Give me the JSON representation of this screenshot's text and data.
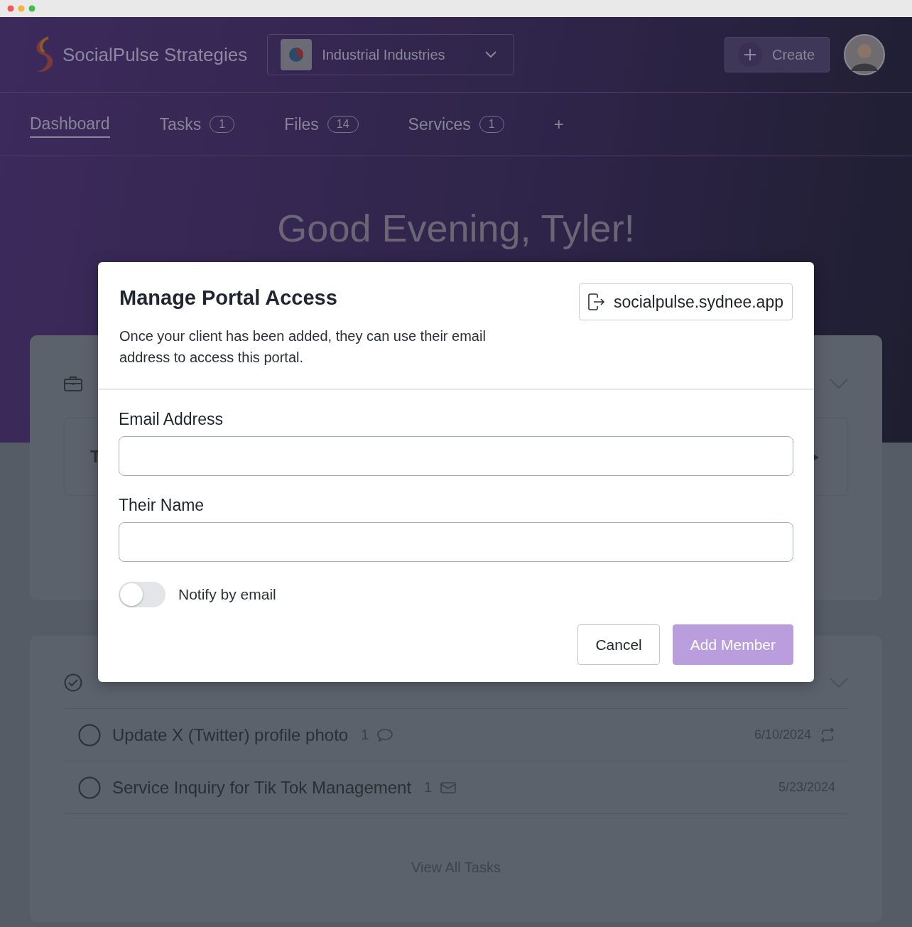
{
  "header": {
    "brand": "SocialPulse Strategies",
    "workspace": "Industrial Industries",
    "create_button": "Create"
  },
  "tabs": [
    {
      "label": "Dashboard",
      "selected": true
    },
    {
      "label": "Tasks",
      "count": "1",
      "selected": false
    },
    {
      "label": "Files",
      "count": "14",
      "selected": false
    },
    {
      "label": "Services",
      "count": "1",
      "selected": false
    }
  ],
  "add_tab": "+",
  "greeting": "Good Evening, Tyler!",
  "card": {
    "item_title": "T"
  },
  "tasks": {
    "rows": [
      {
        "title": "Update X (Twitter) profile photo",
        "checked": false,
        "count": "1",
        "kind": "comment",
        "date": "6/10/2024",
        "recurring": true
      },
      {
        "title": "Service Inquiry for Tik Tok Management",
        "checked": false,
        "count": "1",
        "kind": "email",
        "date": "5/23/2024",
        "recurring": false
      }
    ],
    "view_all": "View All Tasks"
  },
  "modal": {
    "title": "Manage Portal Access",
    "link": "socialpulse.sydnee.app",
    "description": "Once your client has been added, they can use their email address to access this portal.",
    "fields": [
      {
        "label": "Email Address"
      },
      {
        "label": "Their Name"
      }
    ],
    "notify": {
      "label": "Notify by email",
      "on": false
    },
    "buttons": [
      {
        "label": "Cancel",
        "kind": "secondary"
      },
      {
        "label": "Add Member",
        "kind": "primary"
      }
    ]
  }
}
